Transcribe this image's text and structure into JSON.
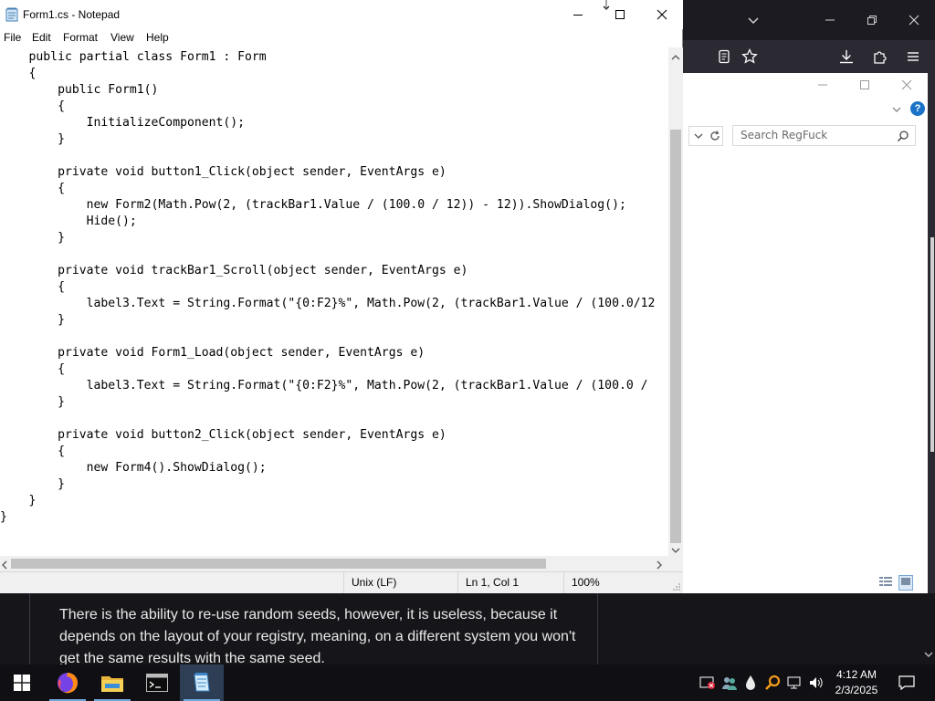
{
  "notepad": {
    "title": "Form1.cs - Notepad",
    "menu": [
      "File",
      "Edit",
      "Format",
      "View",
      "Help"
    ],
    "code_lines": [
      "    public partial class Form1 : Form",
      "    {",
      "        public Form1()",
      "        {",
      "            InitializeComponent();",
      "        }",
      "",
      "        private void button1_Click(object sender, EventArgs e)",
      "        {",
      "            new Form2(Math.Pow(2, (trackBar1.Value / (100.0 / 12)) - 12)).ShowDialog();",
      "            Hide();",
      "        }",
      "",
      "        private void trackBar1_Scroll(object sender, EventArgs e)",
      "        {",
      "            label3.Text = String.Format(\"{0:F2}%\", Math.Pow(2, (trackBar1.Value / (100.0/12",
      "        }",
      "",
      "        private void Form1_Load(object sender, EventArgs e)",
      "        {",
      "            label3.Text = String.Format(\"{0:F2}%\", Math.Pow(2, (trackBar1.Value / (100.0 /",
      "        }",
      "",
      "        private void button2_Click(object sender, EventArgs e)",
      "        {",
      "            new Form4().ShowDialog();",
      "        }",
      "    }",
      "}"
    ],
    "status": {
      "line_ending": "Unix (LF)",
      "position": "Ln 1, Col 1",
      "zoom": "100%"
    }
  },
  "regfuck": {
    "search_placeholder": "Search RegFuck",
    "help_label": "?"
  },
  "webpage": {
    "paragraph": "There is the ability to re-use random seeds, however, it is useless, because it depends on the layout of your registry, meaning, on a different system you won't get the same results with the same seed."
  },
  "taskbar": {
    "apps": [
      "firefox-icon",
      "file-explorer-icon",
      "terminal-icon",
      "notepad-icon"
    ],
    "active_app": "notepad-icon",
    "time": "4:12 AM",
    "date": "2/3/2025"
  },
  "colors": {
    "taskbar_bg": "#101014",
    "browser_dark": "#1c1b22",
    "accent": "#6fa8dc",
    "help_blue": "#1a73c8"
  }
}
